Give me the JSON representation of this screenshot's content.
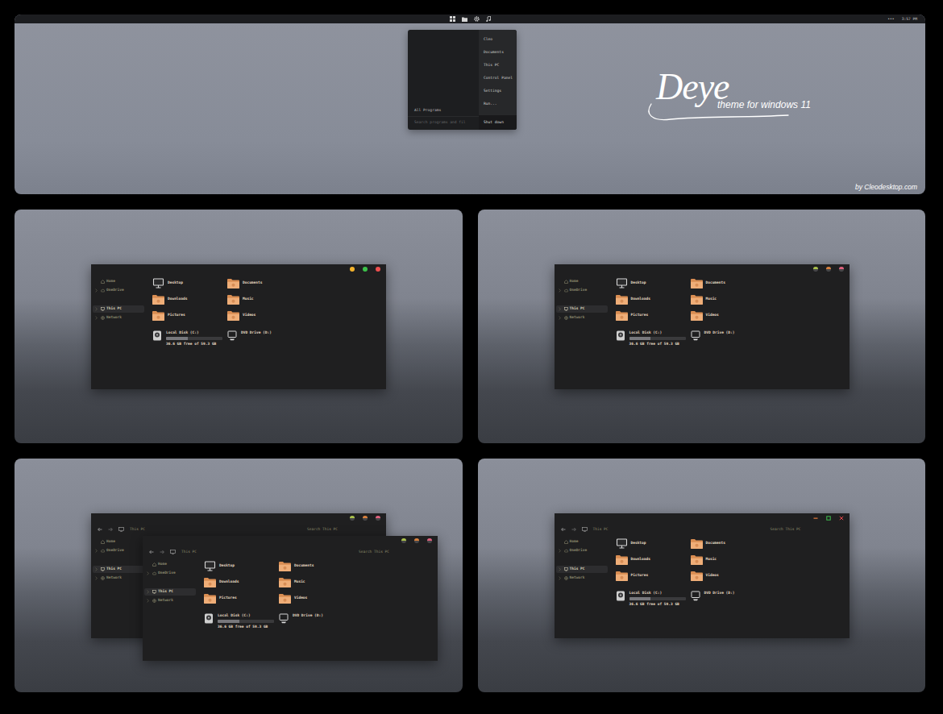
{
  "showcase": {
    "title": "Deye",
    "subtitle": "theme for windows 11",
    "credit": "by Cleodesktop.com"
  },
  "taskbar": {
    "tray": "•••",
    "clock": "3:57 PM"
  },
  "start_menu": {
    "places": [
      {
        "label": "Cleo"
      },
      {
        "label": "Documents"
      },
      {
        "label": "This PC"
      },
      {
        "label": "Control Panel"
      },
      {
        "label": "Settings"
      },
      {
        "label": "Run..."
      }
    ],
    "power": "Shut down",
    "all_programs": "All Programs",
    "search_placeholder": "Search programs and fil"
  },
  "screens": [
    {
      "windows": [
        {
          "caption_style": "dots",
          "caption_buttons": [
            {
              "kind": "minimize",
              "color": "#f4b32c"
            },
            {
              "kind": "maximize",
              "color": "#3cc24a"
            },
            {
              "kind": "close",
              "color": "#ee4f4f"
            }
          ],
          "sidebar": [
            {
              "label": "Home",
              "kind": "home",
              "chevron": false,
              "selected": false
            },
            {
              "label": "OneDrive",
              "kind": "cloud",
              "chevron": true,
              "selected": false
            },
            {
              "label": "This PC",
              "kind": "pc",
              "chevron": true,
              "selected": true
            },
            {
              "label": "Network",
              "kind": "network",
              "chevron": true,
              "selected": false
            }
          ],
          "folders": [
            {
              "name": "Desktop",
              "kind": "monitor"
            },
            {
              "name": "Documents",
              "kind": "folder"
            },
            {
              "name": "Downloads",
              "kind": "folder"
            },
            {
              "name": "Music",
              "kind": "folder"
            },
            {
              "name": "Pictures",
              "kind": "folder"
            },
            {
              "name": "Videos",
              "kind": "folder"
            }
          ],
          "drives": [
            {
              "name": "Local Disk (C:)",
              "kind": "disk",
              "level": 0.38,
              "free": "36.6 GB free of 59.3 GB"
            },
            {
              "name": "DVD Drive (D:)",
              "kind": "optical"
            }
          ]
        }
      ]
    },
    {
      "windows": [
        {
          "caption_style": "faces",
          "caption_buttons": [
            {
              "kind": "minimize",
              "color": "#a9c14a"
            },
            {
              "kind": "maximize",
              "color": "#d9803c"
            },
            {
              "kind": "close",
              "color": "#e0607e"
            }
          ],
          "sidebar": [
            {
              "label": "Home",
              "kind": "home",
              "chevron": false,
              "selected": false
            },
            {
              "label": "OneDrive",
              "kind": "cloud",
              "chevron": true,
              "selected": false
            },
            {
              "label": "This PC",
              "kind": "pc",
              "chevron": true,
              "selected": true
            },
            {
              "label": "Network",
              "kind": "network",
              "chevron": true,
              "selected": false
            }
          ],
          "folders": [
            {
              "name": "Desktop",
              "kind": "monitor"
            },
            {
              "name": "Documents",
              "kind": "folder"
            },
            {
              "name": "Downloads",
              "kind": "folder"
            },
            {
              "name": "Music",
              "kind": "folder"
            },
            {
              "name": "Pictures",
              "kind": "folder"
            },
            {
              "name": "Videos",
              "kind": "folder"
            }
          ],
          "drives": [
            {
              "name": "Local Disk (C:)",
              "kind": "disk",
              "level": 0.38,
              "free": "36.6 GB free of 59.3 GB"
            },
            {
              "name": "DVD Drive (D:)",
              "kind": "optical"
            }
          ]
        }
      ]
    },
    {
      "windows": [
        {
          "caption_style": "faces",
          "caption_buttons": [
            {
              "kind": "minimize",
              "color": "#a9c14a"
            },
            {
              "kind": "maximize",
              "color": "#d9803c"
            },
            {
              "kind": "close",
              "color": "#e0607e"
            }
          ],
          "toolbar": {
            "location": "This PC",
            "search_placeholder": "Search This PC"
          },
          "sidebar": [
            {
              "label": "Home",
              "kind": "home",
              "chevron": false,
              "selected": false
            },
            {
              "label": "OneDrive",
              "kind": "cloud",
              "chevron": true,
              "selected": false
            },
            {
              "label": "This PC",
              "kind": "pc",
              "chevron": true,
              "selected": true
            },
            {
              "label": "Network",
              "kind": "network",
              "chevron": true,
              "selected": false
            }
          ],
          "folders": [],
          "drives": []
        },
        {
          "caption_style": "faces",
          "caption_buttons": [
            {
              "kind": "minimize",
              "color": "#a9c14a"
            },
            {
              "kind": "maximize",
              "color": "#d9803c"
            },
            {
              "kind": "close",
              "color": "#e0607e"
            }
          ],
          "toolbar": {
            "location": "This PC",
            "search_placeholder": "Search This PC"
          },
          "sidebar": [
            {
              "label": "Home",
              "kind": "home",
              "chevron": false,
              "selected": false
            },
            {
              "label": "OneDrive",
              "kind": "cloud",
              "chevron": true,
              "selected": false
            },
            {
              "label": "This PC",
              "kind": "pc",
              "chevron": true,
              "selected": true
            },
            {
              "label": "Network",
              "kind": "network",
              "chevron": true,
              "selected": false
            }
          ],
          "folders": [
            {
              "name": "Desktop",
              "kind": "monitor"
            },
            {
              "name": "Documents",
              "kind": "folder"
            },
            {
              "name": "Downloads",
              "kind": "folder"
            },
            {
              "name": "Music",
              "kind": "folder"
            },
            {
              "name": "Pictures",
              "kind": "folder"
            },
            {
              "name": "Videos",
              "kind": "folder"
            }
          ],
          "drives": [
            {
              "name": "Local Disk (C:)",
              "kind": "disk",
              "level": 0.38,
              "free": "36.6 GB free of 59.3 GB"
            },
            {
              "name": "DVD Drive (D:)",
              "kind": "optical"
            }
          ]
        }
      ]
    },
    {
      "windows": [
        {
          "caption_style": "glyphs",
          "caption_buttons": [
            {
              "kind": "minimize",
              "color": "#e0773a"
            },
            {
              "kind": "maximize",
              "color": "#3fbf4f"
            },
            {
              "kind": "close",
              "color": "#e8474a"
            }
          ],
          "toolbar": {
            "location": "This PC",
            "search_placeholder": "Search This PC"
          },
          "sidebar": [
            {
              "label": "Home",
              "kind": "home",
              "chevron": false,
              "selected": false
            },
            {
              "label": "OneDrive",
              "kind": "cloud",
              "chevron": true,
              "selected": false
            },
            {
              "label": "This PC",
              "kind": "pc",
              "chevron": true,
              "selected": true
            },
            {
              "label": "Network",
              "kind": "network",
              "chevron": true,
              "selected": false
            }
          ],
          "folders": [
            {
              "name": "Desktop",
              "kind": "monitor"
            },
            {
              "name": "Documents",
              "kind": "folder"
            },
            {
              "name": "Downloads",
              "kind": "folder"
            },
            {
              "name": "Music",
              "kind": "folder"
            },
            {
              "name": "Pictures",
              "kind": "folder"
            },
            {
              "name": "Videos",
              "kind": "folder"
            }
          ],
          "drives": [
            {
              "name": "Local Disk (C:)",
              "kind": "disk",
              "level": 0.38,
              "free": "36.6 GB free of 59.3 GB"
            },
            {
              "name": "DVD Drive (D:)",
              "kind": "optical"
            }
          ]
        }
      ]
    }
  ]
}
